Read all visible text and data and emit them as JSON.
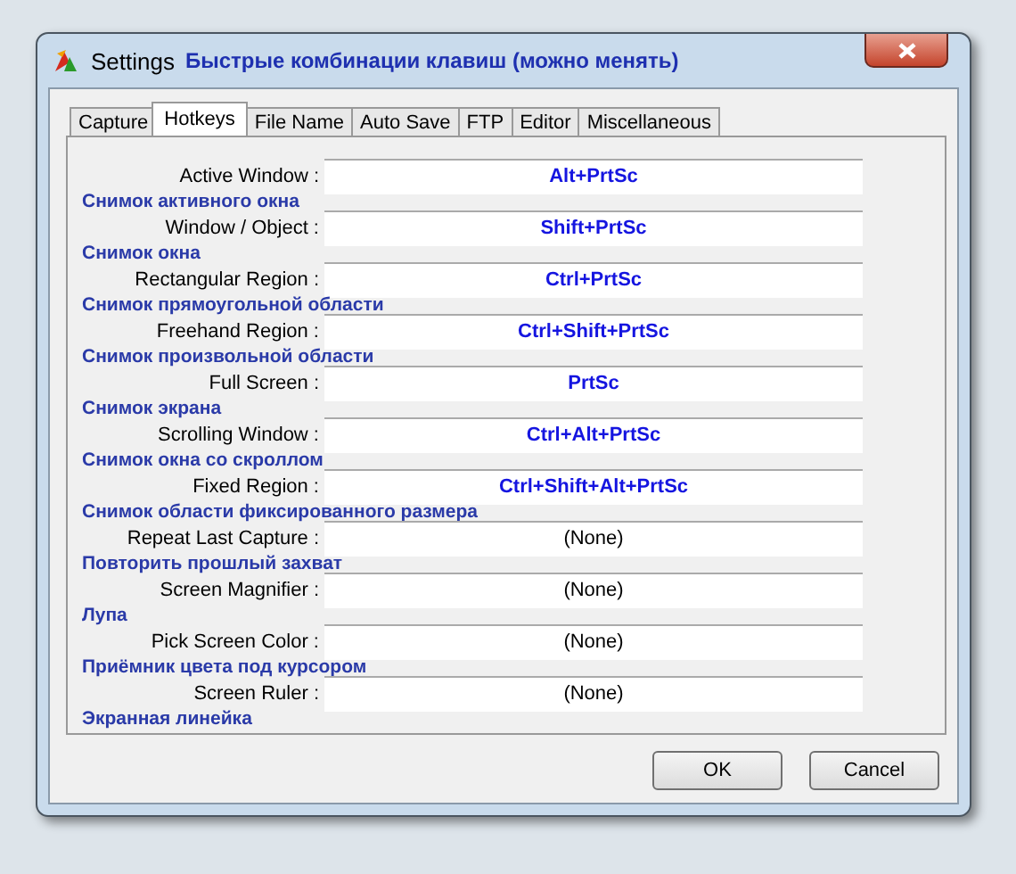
{
  "window": {
    "title": "Settings",
    "subtitle": "Быстрые комбинации клавиш (можно менять)"
  },
  "tabs": [
    {
      "label": "Capture",
      "selected": false
    },
    {
      "label": "Hotkeys",
      "selected": true
    },
    {
      "label": "File Name",
      "selected": false
    },
    {
      "label": "Auto Save",
      "selected": false
    },
    {
      "label": "FTP",
      "selected": false
    },
    {
      "label": "Editor",
      "selected": false
    },
    {
      "label": "Miscellaneous",
      "selected": false
    }
  ],
  "hotkeys": [
    {
      "label": "Active Window :",
      "caption": "Снимок активного окна",
      "value": "Alt+PrtSc",
      "assigned": true
    },
    {
      "label": "Window / Object :",
      "caption": "Снимок окна",
      "value": "Shift+PrtSc",
      "assigned": true
    },
    {
      "label": "Rectangular Region :",
      "caption": "Снимок прямоугольной области",
      "value": "Ctrl+PrtSc",
      "assigned": true
    },
    {
      "label": "Freehand Region :",
      "caption": "Снимок произвольной области",
      "value": "Ctrl+Shift+PrtSc",
      "assigned": true
    },
    {
      "label": "Full Screen :",
      "caption": "Снимок экрана",
      "value": "PrtSc",
      "assigned": true
    },
    {
      "label": "Scrolling Window :",
      "caption": "Снимок окна со скроллом",
      "value": "Ctrl+Alt+PrtSc",
      "assigned": true
    },
    {
      "label": "Fixed Region :",
      "caption": "Снимок области фиксированного размера",
      "value": "Ctrl+Shift+Alt+PrtSc",
      "assigned": true
    },
    {
      "label": "Repeat Last Capture :",
      "caption": "Повторить прошлый захват",
      "value": "(None)",
      "assigned": false
    },
    {
      "label": "Screen Magnifier :",
      "caption": "Лупа",
      "value": "(None)",
      "assigned": false
    },
    {
      "label": "Pick Screen Color :",
      "caption": "Приёмник цвета под курсором",
      "value": "(None)",
      "assigned": false
    },
    {
      "label": "Screen Ruler :",
      "caption": "Экранная линейка",
      "value": "(None)",
      "assigned": false
    }
  ],
  "buttons": [
    "OK",
    "Cancel"
  ]
}
